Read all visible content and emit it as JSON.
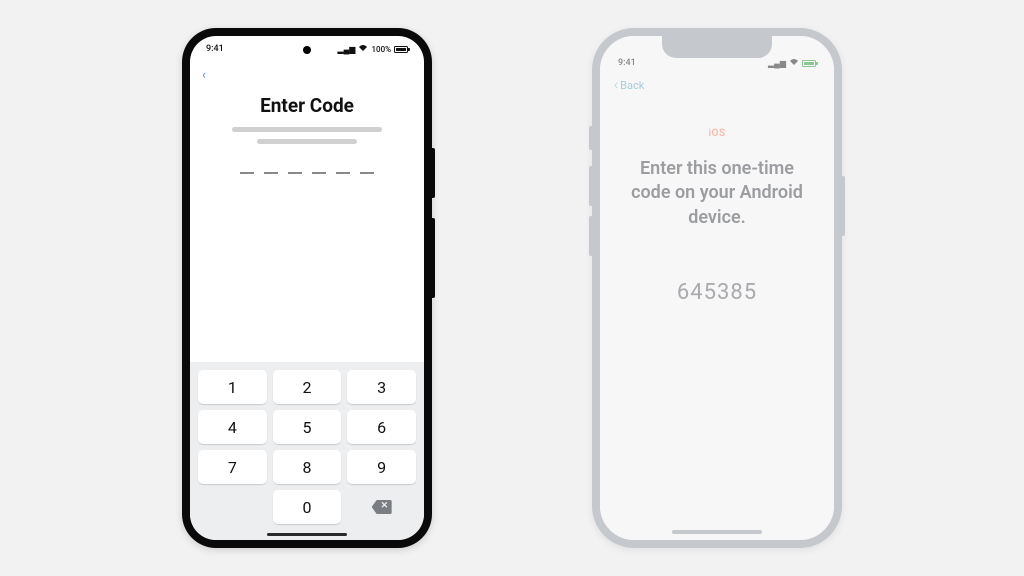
{
  "android": {
    "status": {
      "time": "9:41",
      "battery": "100%",
      "signal_icon": "signal-icon",
      "wifi_icon": "wifi-icon"
    },
    "title": "Enter Code",
    "code_length": 6,
    "keypad": {
      "k1": "1",
      "k2": "2",
      "k3": "3",
      "k4": "4",
      "k5": "5",
      "k6": "6",
      "k7": "7",
      "k8": "8",
      "k9": "9",
      "k0": "0"
    }
  },
  "ios": {
    "status": {
      "time": "9:41"
    },
    "back_label": "Back",
    "small_label": "iOS",
    "title": "Enter this one-time code on your Android device.",
    "code": "645385"
  }
}
